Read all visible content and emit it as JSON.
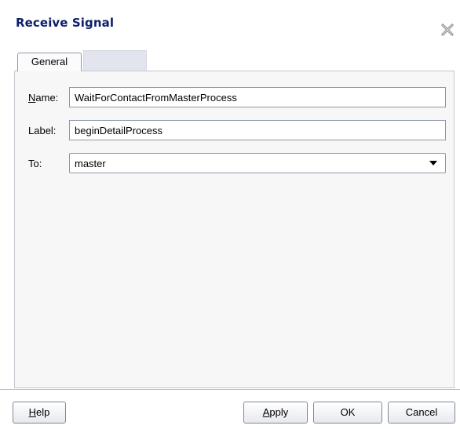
{
  "dialog": {
    "title": "Receive Signal",
    "close_icon": "close-x-icon"
  },
  "tabs": [
    {
      "label": "General",
      "selected": true
    },
    {
      "label": ""
    }
  ],
  "form": {
    "name": {
      "mnemonic": "N",
      "label_rest": "ame:",
      "value": "WaitForContactFromMasterProcess"
    },
    "label": {
      "label": "Label:",
      "value": "beginDetailProcess"
    },
    "to": {
      "label": "To:",
      "value": "master"
    }
  },
  "buttons": {
    "help": {
      "mnemonic": "H",
      "rest": "elp"
    },
    "apply": {
      "mnemonic": "A",
      "rest": "pply"
    },
    "ok": {
      "label": "OK"
    },
    "cancel": {
      "label": "Cancel"
    }
  }
}
